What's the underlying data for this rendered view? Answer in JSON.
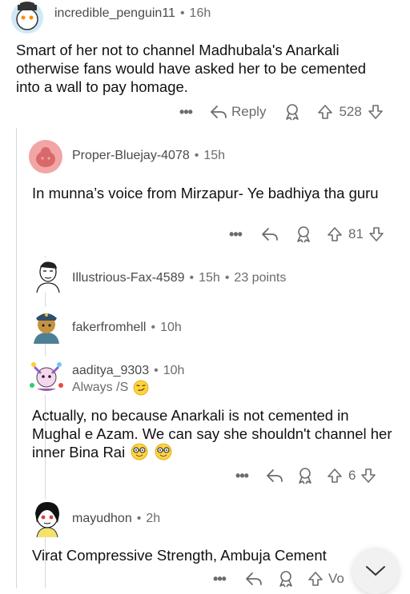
{
  "comments": [
    {
      "username": "incredible_penguin11",
      "age": "16h",
      "body": "Smart of her not to channel Madhubala's Anarkali otherwise fans would have asked her to be cemented into a wall to pay homage.",
      "reply_label": "Reply",
      "votes": "528"
    },
    {
      "username": "Proper-Bluejay-4078",
      "age": "15h",
      "body": "In munna’s voice from Mirzapur- Ye badhiya tha guru",
      "votes": "81"
    },
    {
      "username": "Illustrious-Fax-4589",
      "age": "15h",
      "score": "23 points"
    },
    {
      "username": "fakerfromhell",
      "age": "10h"
    },
    {
      "username": "aaditya_9303",
      "age": "10h",
      "flair": "Always /S",
      "body": "Actually, no because Anarkali is not cemented in Mughal e Azam. We can say she shouldn't channel her inner Bina Rai",
      "votes": "6"
    },
    {
      "username": "mayudhon",
      "age": "2h",
      "body": "Virat Compressive Strength, Ambuja Cement",
      "votes_partial": "Vo"
    }
  ],
  "icons": {
    "more": "more-options-icon",
    "reply": "reply-arrow-icon",
    "award": "award-icon",
    "upvote": "upvote-arrow-icon",
    "downvote": "downvote-arrow-icon",
    "collapse": "chevron-down-icon"
  },
  "colors": {
    "text_primary": "#1a1a1b",
    "meta": "#6b6b6b",
    "fab_bg": "#f1f1f1"
  }
}
